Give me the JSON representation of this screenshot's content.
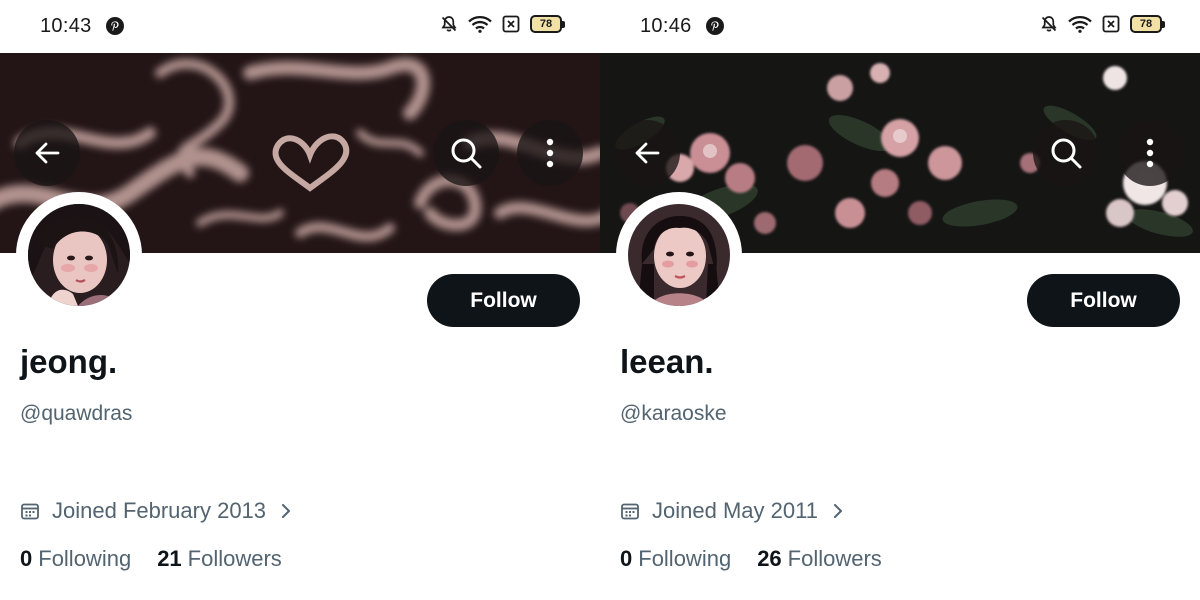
{
  "screens": [
    {
      "status_time": "10:43",
      "battery": "78",
      "follow_label": "Follow",
      "display_name": "jeong.",
      "handle": "@quawdras",
      "joined": "Joined February 2013",
      "following_count": "0",
      "following_label": "Following",
      "followers_count": "21",
      "followers_label": "Followers"
    },
    {
      "status_time": "10:46",
      "battery": "78",
      "follow_label": "Follow",
      "display_name": "leean.",
      "handle": "@karaoske",
      "joined": "Joined May 2011",
      "following_count": "0",
      "following_label": "Following",
      "followers_count": "26",
      "followers_label": "Followers"
    }
  ],
  "icons": {
    "status_left": "pinterest-icon",
    "status_right": [
      "bell-off-icon",
      "wifi-icon",
      "no-sim-icon",
      "battery-icon"
    ],
    "header": [
      "back-arrow-icon",
      "search-icon",
      "more-vertical-icon"
    ],
    "joined": "calendar-icon",
    "joined_chevron": "chevron-right-icon"
  },
  "colors": {
    "follow_button": "#0f1419",
    "secondary_text": "#536471",
    "banner_left": "#231516",
    "banner_right": "#151514"
  }
}
